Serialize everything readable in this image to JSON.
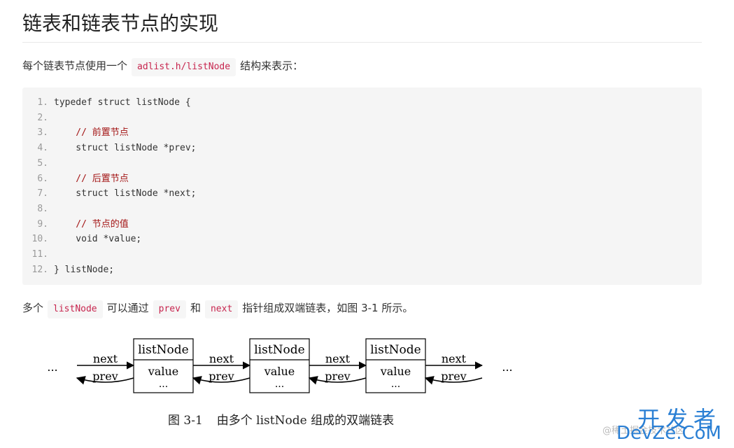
{
  "title": "链表和链表节点的实现",
  "para1": {
    "before": "每个链表节点使用一个",
    "code": "adlist.h/listNode",
    "after": "结构来表示："
  },
  "code": {
    "lines": [
      {
        "n": "1.",
        "indent": "",
        "text": "typedef struct listNode {",
        "comment": false
      },
      {
        "n": "2.",
        "indent": "",
        "text": "",
        "comment": false
      },
      {
        "n": "3.",
        "indent": "    ",
        "text": "// 前置节点",
        "comment": true
      },
      {
        "n": "4.",
        "indent": "    ",
        "text": "struct listNode *prev;",
        "comment": false
      },
      {
        "n": "5.",
        "indent": "",
        "text": "",
        "comment": false
      },
      {
        "n": "6.",
        "indent": "    ",
        "text": "// 后置节点",
        "comment": true
      },
      {
        "n": "7.",
        "indent": "    ",
        "text": "struct listNode *next;",
        "comment": false
      },
      {
        "n": "8.",
        "indent": "",
        "text": "",
        "comment": false
      },
      {
        "n": "9.",
        "indent": "    ",
        "text": "// 节点的值",
        "comment": true
      },
      {
        "n": "10.",
        "indent": "    ",
        "text": "void *value;",
        "comment": false
      },
      {
        "n": "11.",
        "indent": "",
        "text": "",
        "comment": false
      },
      {
        "n": "12.",
        "indent": "",
        "text": "} listNode;",
        "comment": false
      }
    ]
  },
  "para2": {
    "t1": "多个",
    "c1": "listNode",
    "t2": "可以通过",
    "c2": "prev",
    "t3": "和",
    "c3": "next",
    "t4": "指针组成双端链表，如图 3-1 所示。"
  },
  "figure": {
    "ellipsis": "...",
    "node_title": "listNode",
    "node_value": "value",
    "node_more": "...",
    "next_label": "next",
    "prev_label": "prev",
    "caption_num": "图 3-1",
    "caption_text": "由多个 listNode 组成的双端链表"
  },
  "watermark": {
    "cn": "开发者",
    "en": "DevZe.CoM",
    "small": "@稀土掘金技术社区"
  }
}
